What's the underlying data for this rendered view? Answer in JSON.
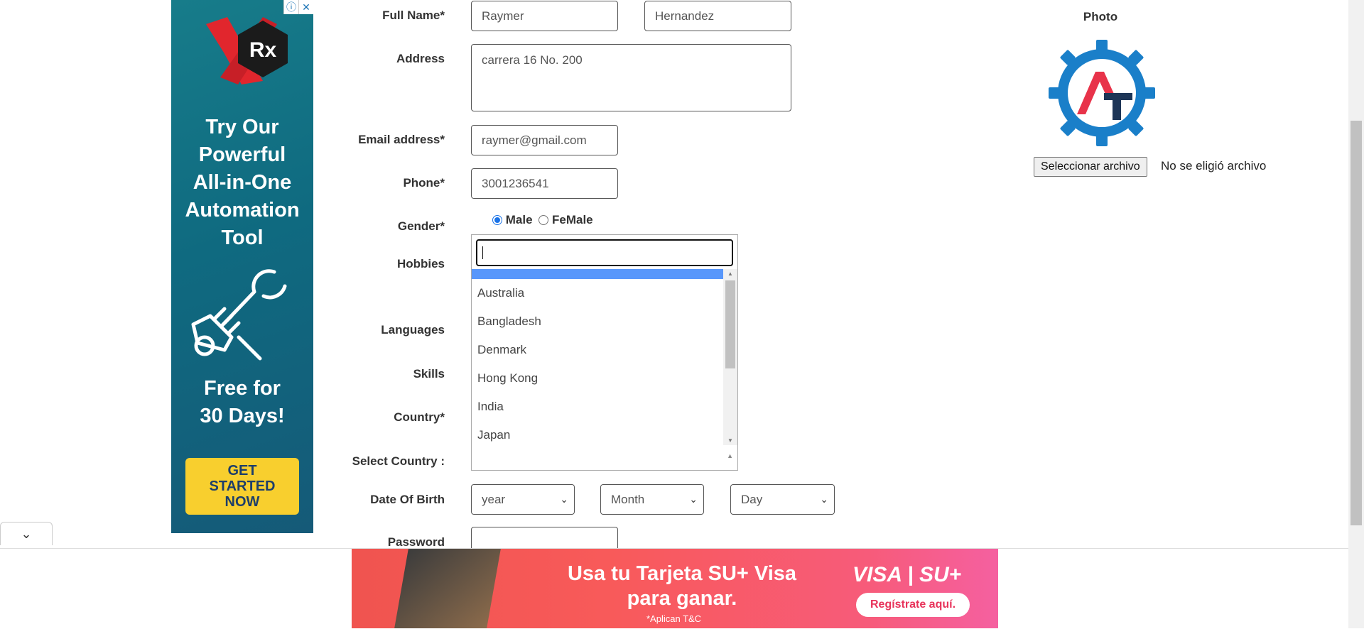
{
  "ad_left": {
    "brand": "Rx",
    "headline": [
      "Try Our",
      "Powerful",
      "All-in-One",
      "Automation",
      "Tool"
    ],
    "offer": [
      "Free for",
      "30 Days!"
    ],
    "cta": [
      "GET",
      "STARTED",
      "NOW"
    ],
    "icons": [
      "info-icon",
      "close-icon"
    ]
  },
  "form": {
    "full_name_label": "Full Name*",
    "first_name_value": "Raymer",
    "last_name_value": "Hernandez",
    "address_label": "Address",
    "address_value": "carrera 16 No. 200",
    "email_label": "Email address*",
    "email_value": "raymer@gmail.com",
    "phone_label": "Phone*",
    "phone_value": "3001236541",
    "gender_label": "Gender*",
    "gender_options": [
      "Male",
      "FeMale"
    ],
    "gender_selected": "Male",
    "hobbies_label": "Hobbies",
    "languages_label": "Languages",
    "skills_label": "Skills",
    "country_label": "Country*",
    "select_country_label": "Select Country :",
    "dob_label": "Date Of Birth",
    "dob_year": "year",
    "dob_month": "Month",
    "dob_day": "Day",
    "password_label": "Password"
  },
  "country_dropdown": {
    "search_value": "",
    "options": [
      "",
      "Australia",
      "Bangladesh",
      "Denmark",
      "Hong Kong",
      "India",
      "Japan"
    ]
  },
  "photo": {
    "label": "Photo",
    "file_button": "Seleccionar archivo",
    "file_status": "No se eligió archivo"
  },
  "ad_bottom": {
    "message": "Usa tu Tarjeta SU+ Visa para ganar.",
    "terms": "*Aplican T&C",
    "brand": "VISA | SU+",
    "cta": "Regístrate aquí."
  },
  "colors": {
    "ad_left_bg": "#0f6a80",
    "cta_yellow": "#f8cf2e",
    "logo_blue": "#1a7fc9",
    "logo_red": "#e8334a",
    "highlight": "#5897fb"
  }
}
